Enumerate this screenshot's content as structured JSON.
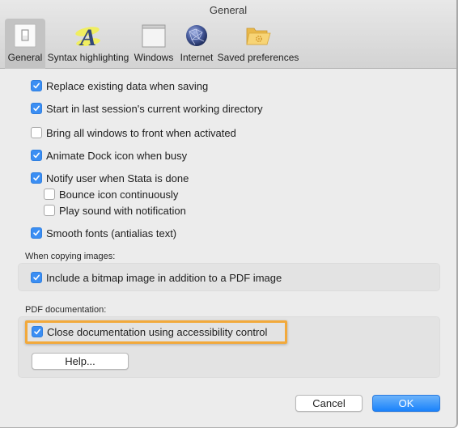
{
  "window": {
    "title": "General"
  },
  "toolbar": {
    "items": [
      {
        "label": "General",
        "icon": "general-switch-icon",
        "selected": true
      },
      {
        "label": "Syntax highlighting",
        "icon": "syntax-highlight-icon",
        "selected": false
      },
      {
        "label": "Windows",
        "icon": "window-icon",
        "selected": false
      },
      {
        "label": "Internet",
        "icon": "globe-icon",
        "selected": false
      },
      {
        "label": "Saved preferences",
        "icon": "folder-gear-icon",
        "selected": false
      }
    ]
  },
  "options": [
    {
      "label": "Replace existing data when saving",
      "checked": true
    },
    {
      "label": "Start in last session's current working directory",
      "checked": true
    },
    {
      "label": "Bring all windows to front when activated",
      "checked": false
    },
    {
      "label": "Animate Dock icon when busy",
      "checked": true
    },
    {
      "label": "Notify user when Stata is done",
      "checked": true
    },
    {
      "label": "Bounce icon continuously",
      "checked": false
    },
    {
      "label": "Play sound with notification",
      "checked": false
    },
    {
      "label": "Smooth fonts (antialias text)",
      "checked": true
    }
  ],
  "copying_images": {
    "label": "When copying images:",
    "option": {
      "label": "Include a bitmap image in addition to a PDF image",
      "checked": true
    }
  },
  "pdf_documentation": {
    "label": "PDF documentation:",
    "option": {
      "label": "Close documentation using accessibility control",
      "checked": true
    },
    "help_label": "Help..."
  },
  "buttons": {
    "cancel": "Cancel",
    "ok": "OK"
  },
  "colors": {
    "accent": "#1a82fb",
    "checkbox": "#3b8ef3",
    "highlight": "#f2a93b"
  }
}
